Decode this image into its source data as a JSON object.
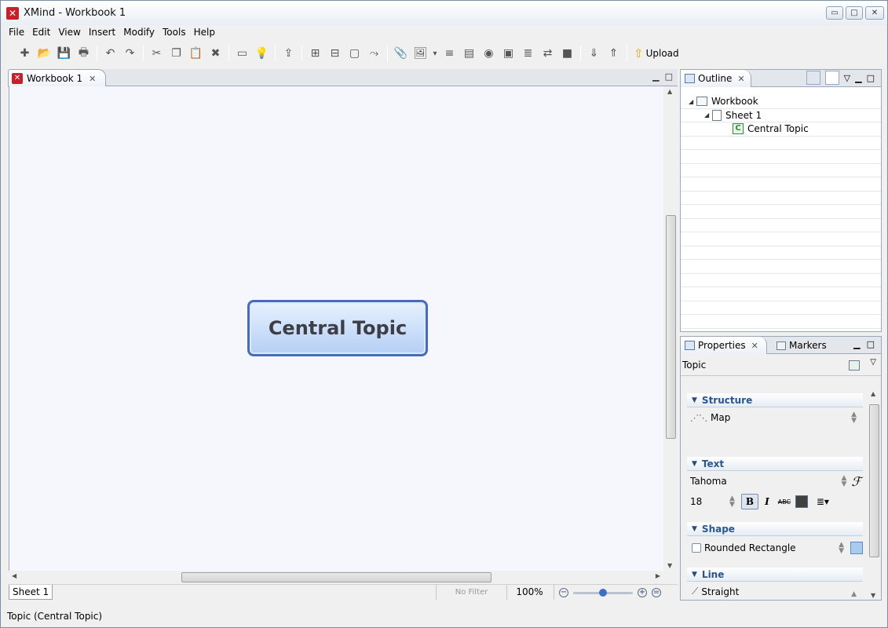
{
  "app": {
    "title": "XMind - Workbook 1",
    "logo_glyph": "✕"
  },
  "window_controls": {
    "minimize": "▭",
    "maximize": "□",
    "close": "✕"
  },
  "menu": [
    "File",
    "Edit",
    "View",
    "Insert",
    "Modify",
    "Tools",
    "Help"
  ],
  "toolbar": {
    "icons": [
      "new-file-icon",
      "open-folder-icon",
      "save-icon",
      "print-icon",
      "sep",
      "undo-icon",
      "redo-icon",
      "sep",
      "cut-icon",
      "copy-icon",
      "paste-icon",
      "delete-icon",
      "sep",
      "presentation-icon",
      "idea-icon",
      "sep",
      "export-icon",
      "sep",
      "subtopic-icon",
      "topic-icon",
      "boundary-icon",
      "relationship-icon",
      "sep",
      "attachment-icon",
      "image-icon",
      "dropdown-icon",
      "structure-icon",
      "note-icon",
      "hyperlink-icon",
      "summary-icon",
      "label-icon",
      "marker-icon",
      "stop-icon",
      "sep",
      "drill-down-icon",
      "drill-up-icon",
      "sep"
    ],
    "glyphs": [
      "✚",
      "📂",
      "💾",
      "🖶",
      "",
      "↶",
      "↷",
      "",
      "✂",
      "❐",
      "📋",
      "✖",
      "",
      "▭",
      "💡",
      "",
      "⇪",
      "",
      "⊞",
      "⊟",
      "▢",
      "⤳",
      "",
      "📎",
      "🖼",
      "▾",
      "≡",
      "▤",
      "◉",
      "▣",
      "≣",
      "⇄",
      "■",
      "",
      "⇓",
      "⇑",
      ""
    ],
    "upload_label": "Upload"
  },
  "editor": {
    "tab_label": "Workbook 1",
    "central_topic": "Central Topic",
    "sheet_tab": "Sheet 1",
    "filter": "No Filter",
    "zoom": "100%",
    "zoom_fraction": 0.5
  },
  "outline": {
    "tab_label": "Outline",
    "tree": [
      {
        "label": "Workbook",
        "level": 0,
        "icon": "workbook-icon"
      },
      {
        "label": "Sheet 1",
        "level": 1,
        "icon": "sheet-icon"
      },
      {
        "label": "Central Topic",
        "level": 2,
        "icon": "topic-c-icon"
      }
    ],
    "empty_rows": 14
  },
  "properties": {
    "tab_label": "Properties",
    "markers_tab": "Markers",
    "context": "Topic",
    "sections": {
      "structure": {
        "title": "Structure",
        "value": "Map"
      },
      "text": {
        "title": "Text",
        "font": "Tahoma",
        "size": "18",
        "color": "#404040"
      },
      "shape": {
        "title": "Shape",
        "value": "Rounded Rectangle",
        "fill": "#a9cbf0"
      },
      "line": {
        "title": "Line",
        "value": "Straight"
      }
    }
  },
  "status": {
    "text": "Topic (Central Topic)"
  }
}
